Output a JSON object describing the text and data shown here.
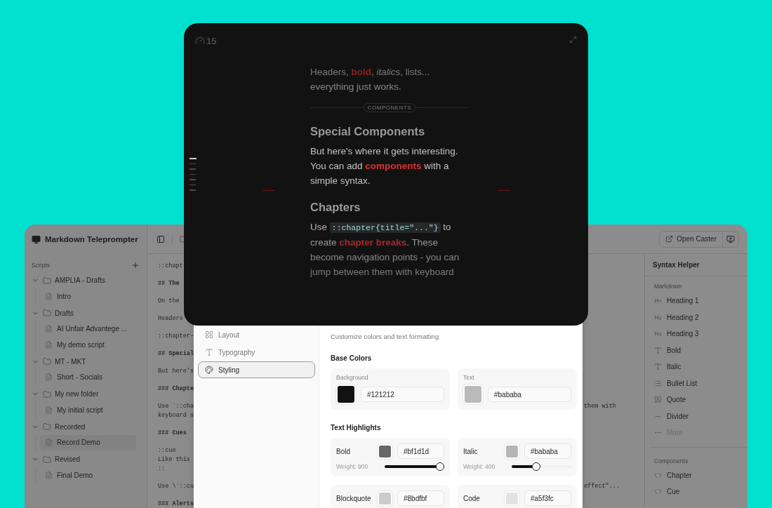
{
  "app": {
    "title": "Markdown Teleprompter",
    "scripts_label": "Scripts",
    "folders": [
      {
        "name": "AMPLIA - Drafts",
        "expanded": true,
        "children": [
          {
            "name": "Intro",
            "selected": false
          }
        ]
      },
      {
        "name": "Drafts",
        "expanded": true,
        "children": [
          {
            "name": "AI Unfair Advantege ...",
            "selected": false
          },
          {
            "name": "My demo script",
            "selected": false
          }
        ]
      },
      {
        "name": "MT - MKT",
        "expanded": true,
        "children": [
          {
            "name": "Short - Socials",
            "selected": false
          }
        ]
      },
      {
        "name": "My new folder",
        "expanded": true,
        "children": [
          {
            "name": "My initial script",
            "selected": false
          }
        ]
      },
      {
        "name": "Recorded",
        "expanded": true,
        "children": [
          {
            "name": "Record Demo",
            "selected": true
          }
        ]
      },
      {
        "name": "Revised",
        "expanded": true,
        "children": [
          {
            "name": "Final Demo",
            "selected": false
          }
        ]
      }
    ],
    "open_caster": "Open Caster",
    "editor_blocks": [
      {
        "bold": false,
        "lines": [
          "::chapt"
        ]
      },
      {
        "bold": true,
        "lines": [
          "## The"
        ]
      },
      {
        "bold": false,
        "lines": [
          "On the"
        ]
      },
      {
        "bold": false,
        "lines": [
          "Headers"
        ]
      },
      {
        "bold": false,
        "lines": [
          "::chapter-"
        ]
      },
      {
        "bold": true,
        "lines": [
          "## Special"
        ]
      },
      {
        "bold": false,
        "lines": [
          "But here's"
        ]
      },
      {
        "bold": true,
        "lines": [
          "### Chapte"
        ]
      },
      {
        "bold": false,
        "lines": [
          "Use `::cha",
          "keyboard s"
        ],
        "tail": "them with"
      },
      {
        "bold": true,
        "lines": [
          "### Cues"
        ]
      },
      {
        "bold": false,
        "lines": [
          "::cue",
          "Like this",
          "::"
        ]
      },
      {
        "bold": false,
        "lines": [
          "Use \\`::cu"
        ],
        "tail": "effect\"..."
      },
      {
        "bold": true,
        "lines": [
          "### Alerts"
        ]
      }
    ],
    "syntax_helper": {
      "title": "Syntax Helper",
      "sections": [
        {
          "title": "Markdown",
          "items": [
            {
              "label": "Heading 1",
              "kind": "h1",
              "disabled": false
            },
            {
              "label": "Heading 2",
              "kind": "h2",
              "disabled": false
            },
            {
              "label": "Heading 3",
              "kind": "h3",
              "disabled": false
            },
            {
              "label": "Bold",
              "kind": "text",
              "disabled": false
            },
            {
              "label": "Italic",
              "kind": "text",
              "disabled": false
            },
            {
              "label": "Bullet List",
              "kind": "list",
              "disabled": false
            },
            {
              "label": "Quote",
              "kind": "quote",
              "disabled": false
            },
            {
              "label": "Divider",
              "kind": "divider",
              "disabled": false
            },
            {
              "label": "More",
              "kind": "more",
              "disabled": true
            }
          ]
        },
        {
          "title": "Components",
          "items": [
            {
              "label": "Chapter",
              "kind": "code",
              "disabled": false
            },
            {
              "label": "Cue",
              "kind": "code",
              "disabled": false
            }
          ]
        }
      ]
    }
  },
  "settings": {
    "nav": [
      {
        "label": "Layout",
        "kind": "layout",
        "selected": false
      },
      {
        "label": "Typography",
        "kind": "type",
        "selected": false
      },
      {
        "label": "Styling",
        "kind": "palette",
        "selected": true
      }
    ],
    "subtitle": "Customize colors and text formatting",
    "sections": [
      {
        "title": "Base Colors",
        "kind": "base",
        "items": [
          {
            "label": "Background",
            "value": "#121212",
            "color": "#121212"
          },
          {
            "label": "Text",
            "value": "#bababa",
            "color": "#bababa"
          }
        ]
      },
      {
        "title": "Text Highlights",
        "kind": "highlight",
        "items": [
          {
            "label": "Bold",
            "value": "#bf1d1d",
            "color": "#666666",
            "weight": "Weight: 900",
            "level": 1
          },
          {
            "label": "Italic",
            "value": "#bababa",
            "color": "#b5b5b5",
            "weight": "Weight: 400",
            "level": 0.4
          },
          {
            "label": "Blockquote",
            "value": "#8bdfbf",
            "color": "#cccccc"
          },
          {
            "label": "Code",
            "value": "#a5f3fc",
            "color": "#e3e3e3"
          }
        ]
      }
    ]
  },
  "teleprompter": {
    "speed": "15",
    "chapter_markers": [
      {
        "selected": true
      },
      {
        "selected": false
      },
      {
        "selected": false
      },
      {
        "selected": false
      },
      {
        "selected": false
      },
      {
        "selected": false
      },
      {
        "selected": false
      }
    ],
    "blocks": [
      {
        "kind": "paragraph",
        "segments": [
          {
            "kind": "text",
            "text": "Headers, "
          },
          {
            "kind": "bold",
            "text": "bold"
          },
          {
            "kind": "text",
            "text": ", "
          },
          {
            "kind": "italic",
            "text": "italics"
          },
          {
            "kind": "text",
            "text": ", lists... everything just works."
          }
        ]
      },
      {
        "kind": "divider",
        "text": "COMPONENTS"
      },
      {
        "kind": "heading",
        "text": "Special Components"
      },
      {
        "kind": "paragraph",
        "segments": [
          {
            "kind": "text",
            "text": "But here's where it gets interesting. You can add "
          },
          {
            "kind": "bold",
            "text": "components"
          },
          {
            "kind": "text",
            "text": " with a simple syntax."
          }
        ]
      },
      {
        "kind": "heading",
        "text": "Chapters"
      },
      {
        "kind": "paragraph",
        "segments": [
          {
            "kind": "text",
            "text": "Use "
          },
          {
            "kind": "code",
            "text": "::chapter{title=\"...\"}"
          },
          {
            "kind": "text",
            "text": " to create "
          },
          {
            "kind": "bold",
            "text": "chapter breaks"
          },
          {
            "kind": "text",
            "text": ". These become navigation points - you can jump between them with keyboard"
          }
        ]
      }
    ]
  }
}
